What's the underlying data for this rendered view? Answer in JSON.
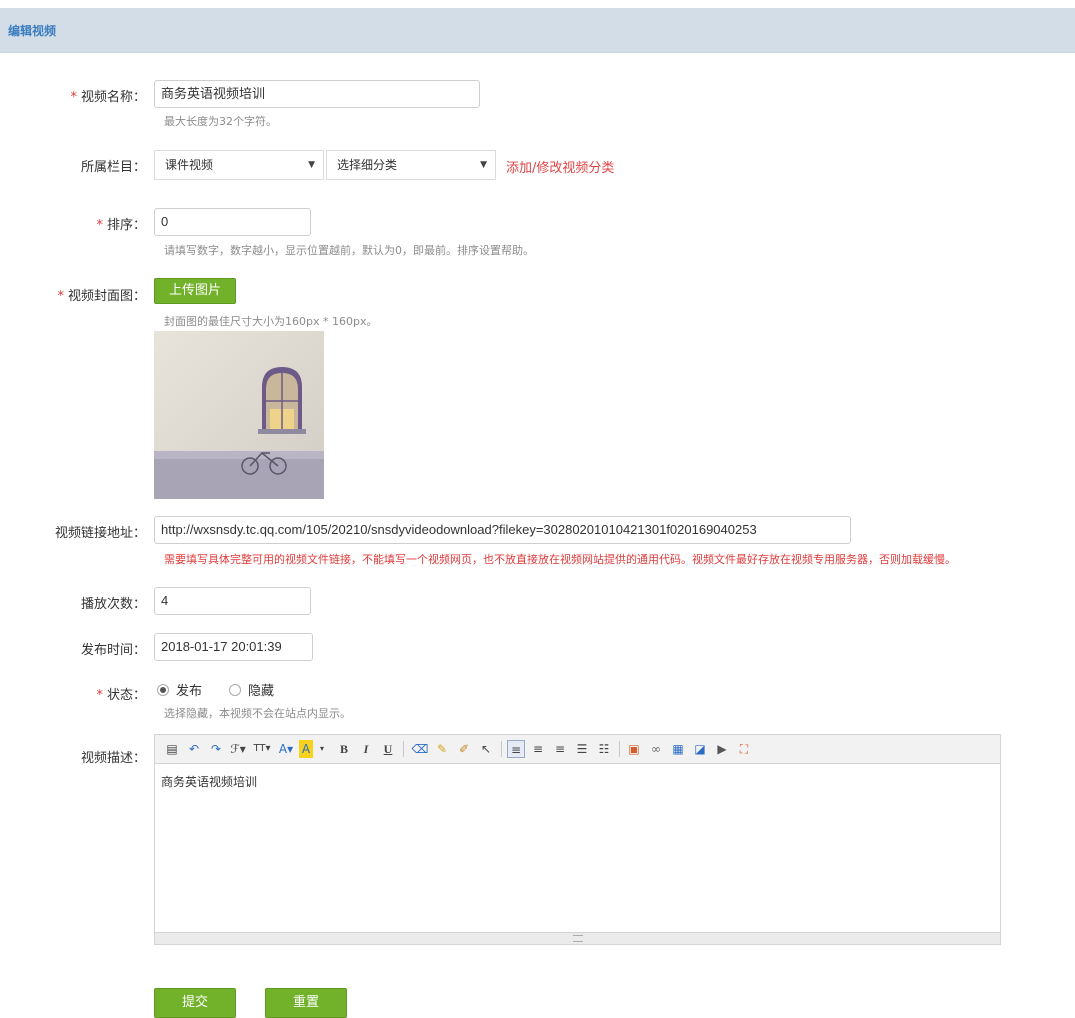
{
  "header": {
    "title": "编辑视频"
  },
  "form": {
    "name": {
      "label": "视频名称：",
      "required": "*",
      "value": "商务英语视频培训",
      "hint": "最大长度为32个字符。"
    },
    "category": {
      "label": "所属栏目：",
      "select1": "课件视频",
      "select2": "选择细分类",
      "link": "添加/修改视频分类"
    },
    "order": {
      "label": "排序：",
      "required": "*",
      "value": "0",
      "hint": "请填写数字，数字越小，显示位置越前，默认为0，即最前。排序设置帮助。"
    },
    "cover": {
      "label": "视频封面图：",
      "required": "*",
      "button": "上传图片",
      "hint": "封面图的最佳尺寸大小为160px * 160px。"
    },
    "url": {
      "label": "视频链接地址：",
      "value": "http://wxsnsdy.tc.qq.com/105/20210/snsdyvideodownload?filekey=30280201010421301f020169040253",
      "warning": "需要填写具体完整可用的视频文件链接，不能填写一个视频网页，也不放直接放在视频网站提供的通用代码。视频文件最好存放在视频专用服务器，否则加载缓慢。"
    },
    "plays": {
      "label": "播放次数：",
      "value": "4"
    },
    "publish_time": {
      "label": "发布时间：",
      "value": "2018-01-17 20:01:39"
    },
    "status": {
      "label": "状态：",
      "required": "*",
      "option_publish": "发布",
      "option_hide": "隐藏",
      "hint": "选择隐藏，本视频不会在站点内显示。"
    },
    "description": {
      "label": "视频描述：",
      "content": "商务英语视频培训",
      "toolbar": {
        "bold": "B",
        "italic": "I",
        "underline": "U",
        "font_color": "A",
        "bg_color": "A"
      }
    }
  },
  "buttons": {
    "submit": "提交",
    "reset": "重置"
  }
}
